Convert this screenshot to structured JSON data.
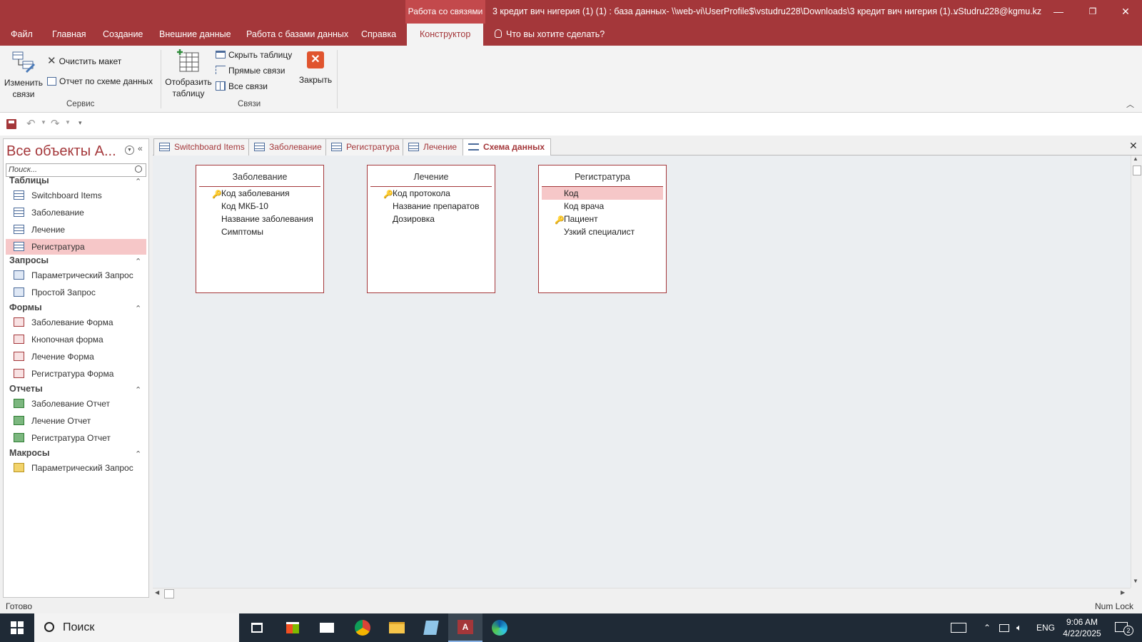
{
  "titlebar": {
    "context_tab": "Работа со связями",
    "document": "3 кредит вич нигерия (1) (1) : база данных- \\\\web-vi\\UserProfile$\\vstudru228\\Downloads\\3 кредит вич нигерия (1)...",
    "user": "vStudru228@kgmu.kz",
    "minimize": "—",
    "restore": "❐",
    "close": "✕"
  },
  "ribbon_tabs": [
    "Файл",
    "Главная",
    "Создание",
    "Внешние данные",
    "Работа с базами данных",
    "Справка",
    "Конструктор"
  ],
  "help_prompt": "Что вы хотите сделать?",
  "ribbon": {
    "edit_relations": "Изменить связи",
    "edit_relations_l1": "Изменить",
    "edit_relations_l2": "связи",
    "clear_layout": "Очистить макет",
    "relationship_report": "Отчет по схеме данных",
    "group_service": "Сервис",
    "show_table_l1": "Отобразить",
    "show_table_l2": "таблицу",
    "hide_table": "Скрыть таблицу",
    "direct_relations": "Прямые связи",
    "all_relations": "Все связи",
    "close": "Закрыть",
    "group_relations": "Связи"
  },
  "nav": {
    "title": "Все объекты А...",
    "search_placeholder": "Поиск...",
    "sections": [
      {
        "title": "Таблицы",
        "items": [
          "Switchboard Items",
          "Заболевание",
          "Лечение",
          "Регистратура"
        ]
      },
      {
        "title": "Запросы",
        "items": [
          "Параметрический Запрос",
          "Простой Запрос"
        ]
      },
      {
        "title": "Формы",
        "items": [
          "Заболевание Форма",
          "Кнопочная форма",
          "Лечение Форма",
          "Регистратура Форма"
        ]
      },
      {
        "title": "Отчеты",
        "items": [
          "Заболевание Отчет",
          "Лечение Отчет",
          "Регистратура Отчет"
        ]
      },
      {
        "title": "Макросы",
        "items": [
          "Параметрический Запрос"
        ]
      }
    ],
    "selected_item": "Регистратура"
  },
  "doc_tabs": [
    "Switchboard Items",
    "Заболевание",
    "Регистратура",
    "Лечение",
    "Схема данных"
  ],
  "active_doc_tab": "Схема данных",
  "tables": [
    {
      "name": "Заболевание",
      "fields": [
        {
          "name": "Код заболевания",
          "key": true
        },
        {
          "name": "Код МКБ-10",
          "key": false
        },
        {
          "name": "Название заболевания",
          "key": false
        },
        {
          "name": "Симптомы",
          "key": false
        }
      ]
    },
    {
      "name": "Лечение",
      "fields": [
        {
          "name": "Код протокола",
          "key": true
        },
        {
          "name": "Название препаратов",
          "key": false
        },
        {
          "name": "Дозировка",
          "key": false
        }
      ]
    },
    {
      "name": "Регистратура",
      "fields": [
        {
          "name": "Код",
          "key": false,
          "selected": true
        },
        {
          "name": "Код врача",
          "key": false
        },
        {
          "name": "Пациент",
          "key": true
        },
        {
          "name": "Узкий специалист",
          "key": false
        }
      ]
    }
  ],
  "status": {
    "left": "Готово",
    "right": "Num Lock"
  },
  "taskbar": {
    "search": "Поиск",
    "lang": "ENG",
    "time": "9:06 AM",
    "date": "4/22/2025",
    "notifications": "2"
  },
  "colors": {
    "accent": "#a4373a",
    "selection": "#f6c7c8",
    "canvas": "#ebeef1"
  }
}
